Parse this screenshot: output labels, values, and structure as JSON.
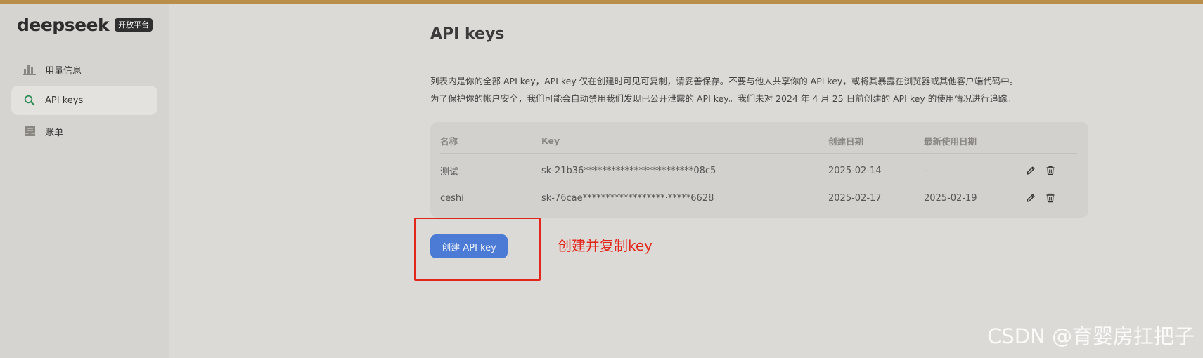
{
  "brand": {
    "name": "deepseek",
    "badge": "开放平台"
  },
  "sidebar": {
    "items": [
      {
        "label": "用量信息",
        "icon": "bar-chart-icon",
        "active": false
      },
      {
        "label": "API keys",
        "icon": "search-icon",
        "active": true
      },
      {
        "label": "账单",
        "icon": "inbox-icon",
        "active": false
      }
    ]
  },
  "page": {
    "title": "API keys",
    "description": [
      "列表内是你的全部 API key，API key 仅在创建时可见可复制，请妥善保存。不要与他人共享你的 API key，或将其暴露在浏览器或其他客户端代码中。",
      "为了保护你的帐户安全，我们可能会自动禁用我们发现已公开泄露的 API key。我们未对 2024 年 4 月 25 日前创建的 API key 的使用情况进行追踪。"
    ]
  },
  "table": {
    "columns": [
      "名称",
      "Key",
      "创建日期",
      "最新使用日期"
    ],
    "rows": [
      {
        "name": "测试",
        "key": "sk-21b36************************08c5",
        "created": "2025-02-14",
        "last_used": "-"
      },
      {
        "name": "ceshi",
        "key": "sk-76cae******************·*****6628",
        "created": "2025-02-17",
        "last_used": "2025-02-19"
      }
    ]
  },
  "actions": {
    "create_label": "创建 API key"
  },
  "annotation": {
    "text": "创建并复制key"
  },
  "watermark": "CSDN @育婴房扛把子",
  "colors": {
    "accent": "#4b7bd4",
    "top_strip": "#b98e49",
    "annotation": "#e3261c",
    "active_icon": "#2e8b57"
  }
}
